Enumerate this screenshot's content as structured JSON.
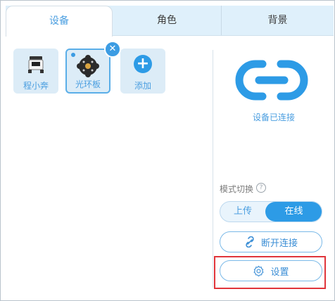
{
  "tabs": [
    {
      "label": "设备",
      "active": true
    },
    {
      "label": "角色",
      "active": false
    },
    {
      "label": "背景",
      "active": false
    }
  ],
  "devices": [
    {
      "label": "程小奔",
      "selected": false,
      "icon": "robot-car-icon"
    },
    {
      "label": "光环板",
      "selected": true,
      "icon": "halo-board-icon"
    },
    {
      "label": "添加",
      "selected": false,
      "icon": "plus-icon"
    }
  ],
  "connection": {
    "icon": "link-icon",
    "status": "设备已连接"
  },
  "mode": {
    "label": "模式切换",
    "help_icon": "question-icon",
    "options": [
      "上传",
      "在线"
    ],
    "selected": "在线"
  },
  "buttons": {
    "disconnect": "断开连接",
    "settings": "设置"
  },
  "colors": {
    "accent": "#2d9be6",
    "highlight": "#e0353b",
    "tab_bar": "#dff0fb"
  }
}
